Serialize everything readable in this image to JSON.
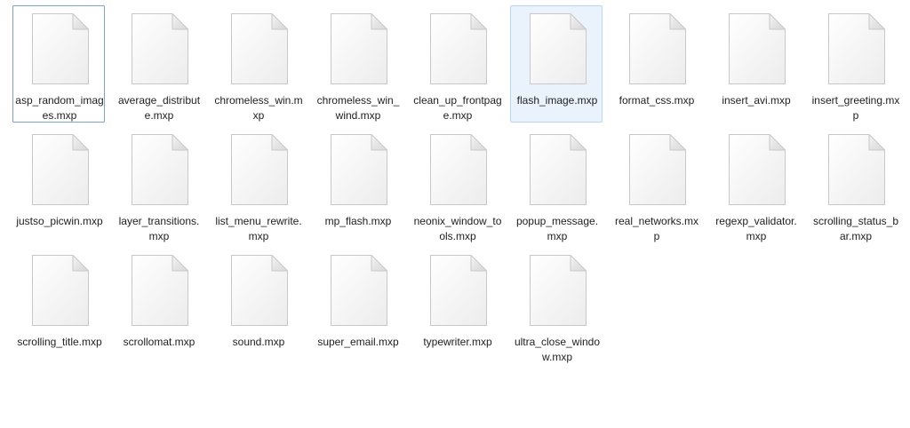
{
  "files": [
    {
      "name": "asp_random_images.mxp",
      "state": "selected"
    },
    {
      "name": "average_distribute.mxp",
      "state": ""
    },
    {
      "name": "chromeless_win.mxp",
      "state": ""
    },
    {
      "name": "chromeless_win_wind.mxp",
      "state": ""
    },
    {
      "name": "clean_up_frontpage.mxp",
      "state": ""
    },
    {
      "name": "flash_image.mxp",
      "state": "hovered"
    },
    {
      "name": "format_css.mxp",
      "state": ""
    },
    {
      "name": "insert_avi.mxp",
      "state": ""
    },
    {
      "name": "insert_greeting.mxp",
      "state": ""
    },
    {
      "name": "justso_picwin.mxp",
      "state": ""
    },
    {
      "name": "layer_transitions.mxp",
      "state": ""
    },
    {
      "name": "list_menu_rewrite.mxp",
      "state": ""
    },
    {
      "name": "mp_flash.mxp",
      "state": ""
    },
    {
      "name": "neonix_window_tools.mxp",
      "state": ""
    },
    {
      "name": "popup_message.mxp",
      "state": ""
    },
    {
      "name": "real_networks.mxp",
      "state": ""
    },
    {
      "name": "regexp_validator.mxp",
      "state": ""
    },
    {
      "name": "scrolling_status_bar.mxp",
      "state": ""
    },
    {
      "name": "scrolling_title.mxp",
      "state": ""
    },
    {
      "name": "scrollomat.mxp",
      "state": ""
    },
    {
      "name": "sound.mxp",
      "state": ""
    },
    {
      "name": "super_email.mxp",
      "state": ""
    },
    {
      "name": "typewriter.mxp",
      "state": ""
    },
    {
      "name": "ultra_close_window.mxp",
      "state": ""
    }
  ],
  "icon": "blank-document-icon"
}
